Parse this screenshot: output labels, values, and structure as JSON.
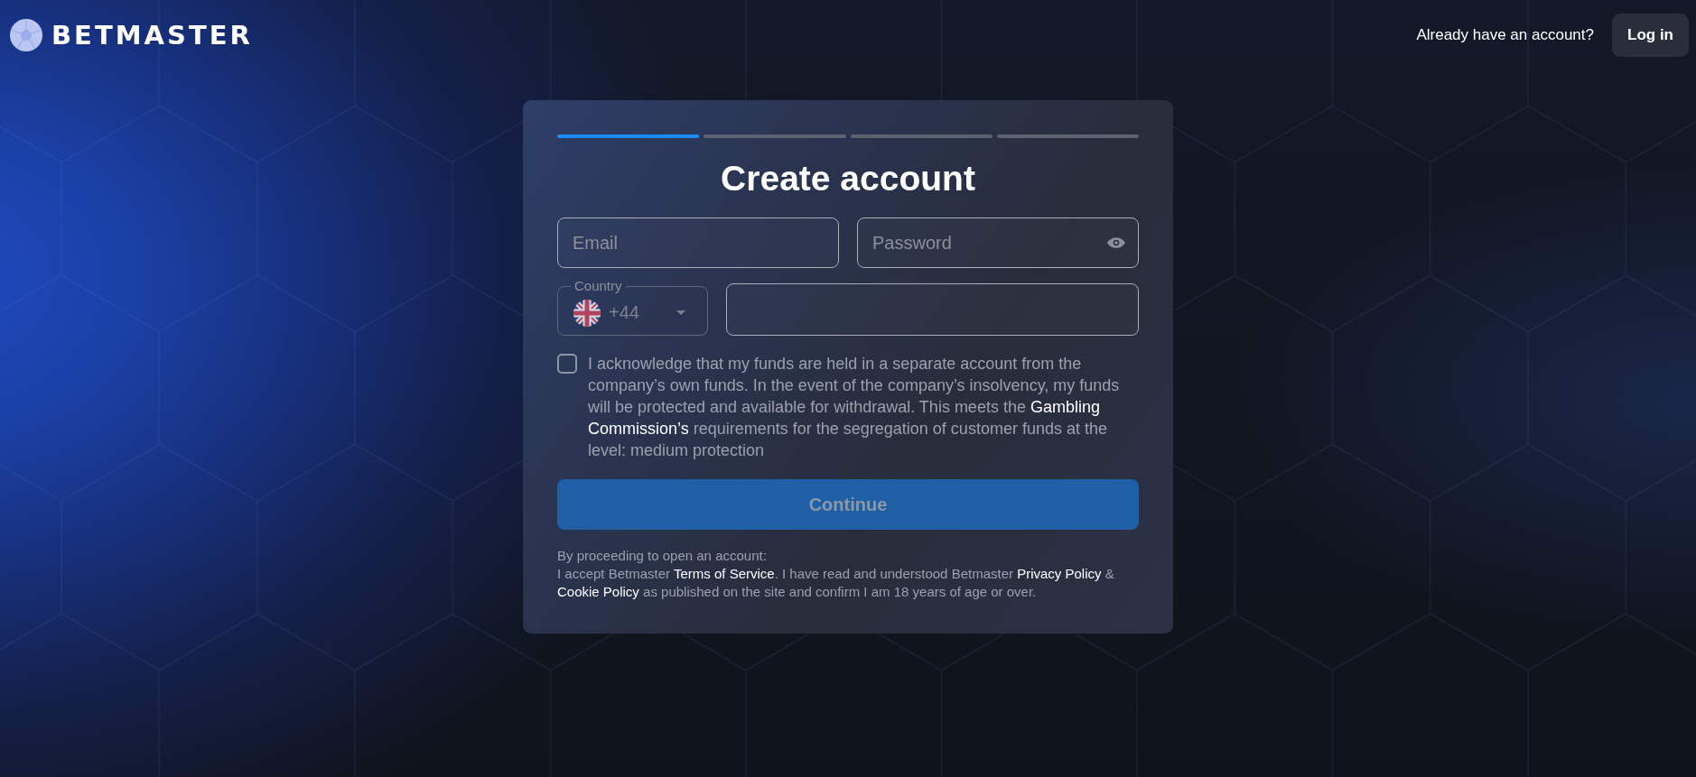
{
  "header": {
    "logo_text": "BETMASTER",
    "login_prompt": "Already have an account?",
    "login_button": "Log in"
  },
  "signup": {
    "steps": [
      {
        "active": true
      },
      {
        "active": false
      },
      {
        "active": false
      },
      {
        "active": false
      }
    ],
    "title": "Create account",
    "email": {
      "placeholder": "Email"
    },
    "password": {
      "placeholder": "Password"
    },
    "country": {
      "label": "Country",
      "value": "+44"
    },
    "consent": {
      "checked": false,
      "text": "I acknowledge that my funds are held in a separate account from the company’s own funds. In the event of the company’s insolvency, my funds will be protected and available for withdrawal. This meets the **Gambling Commission’s** requirements for the segregation of customer funds at the level: medium protection"
    },
    "continue_button": {
      "label": "Continue",
      "disabled": true
    },
    "legal": {
      "intro": "By proceeding to open an account:",
      "segments": [
        {
          "kind": "text",
          "text": "I accept Betmaster "
        },
        {
          "kind": "link",
          "text": "Terms of Service"
        },
        {
          "kind": "text",
          "text": ". I have read and understood Betmaster "
        },
        {
          "kind": "link",
          "text": "Privacy Policy"
        },
        {
          "kind": "text",
          "text": " & "
        },
        {
          "kind": "link",
          "text": "Cookie Policy"
        },
        {
          "kind": "text",
          "text": " as published on the site and confirm I am 18 years of age or over."
        }
      ]
    }
  }
}
